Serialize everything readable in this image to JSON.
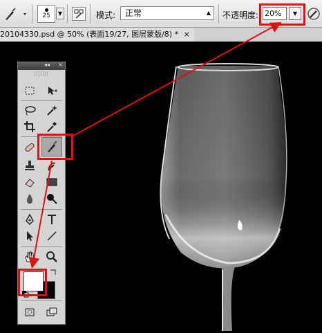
{
  "options_bar": {
    "brush_size": "25",
    "mode_label": "模式:",
    "mode_value": "正常",
    "opacity_label": "不透明度:",
    "opacity_value": "20%"
  },
  "document": {
    "tab_title": "20104330.psd @ 50% (表面19/27, 图层蒙版/8) *",
    "close_label": "×"
  },
  "toolbox": {
    "collapse_label": "◂◂",
    "close_label": "×",
    "tools": [
      "marquee-tool",
      "move-tool",
      "lasso-tool",
      "magic-wand-tool",
      "crop-tool",
      "eyedropper-tool",
      "healing-brush-tool",
      "brush-tool",
      "clone-stamp-tool",
      "history-brush-tool",
      "eraser-tool",
      "gradient-tool",
      "blur-tool",
      "dodge-tool",
      "pen-tool",
      "type-tool",
      "path-selection-tool",
      "line-tool",
      "hand-tool",
      "zoom-tool"
    ],
    "foreground_color": "#ffffff",
    "background_color": "#000000"
  },
  "annotation_color": "#e01010"
}
